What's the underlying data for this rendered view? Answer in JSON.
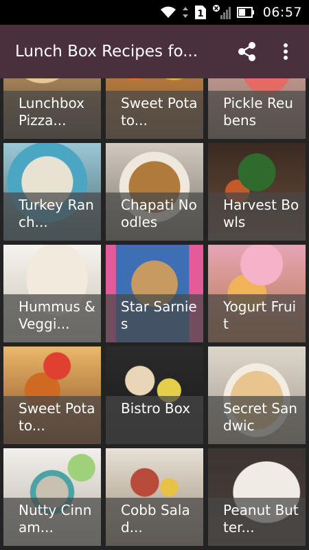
{
  "status_bar": {
    "time": "06:57",
    "sim_badge": "1",
    "icons": [
      "wifi-icon",
      "data-arrows-icon",
      "sim-icon",
      "signal-icon",
      "battery-icon"
    ]
  },
  "app_bar": {
    "title": "Lunch Box Recipes fo...",
    "background": "#4a2f3d",
    "share_icon": "share-icon",
    "menu_icon": "overflow-menu-icon"
  },
  "grid": {
    "recipes": [
      {
        "label": "Lunchbox Pizza..."
      },
      {
        "label": "Sweet Potato..."
      },
      {
        "label": "Pickle Reubens"
      },
      {
        "label": "Turkey Ranch..."
      },
      {
        "label": "Chapati Noodles"
      },
      {
        "label": "Harvest Bowls"
      },
      {
        "label": "Hummus & Veggi..."
      },
      {
        "label": "Star Sarnies"
      },
      {
        "label": "Yogurt Fruit"
      },
      {
        "label": "Sweet Potato..."
      },
      {
        "label": "Bistro Box"
      },
      {
        "label": "Secret Sandwic"
      },
      {
        "label": "Nutty Cinnam..."
      },
      {
        "label": "Cobb Salad..."
      },
      {
        "label": "Peanut Butter..."
      }
    ]
  }
}
